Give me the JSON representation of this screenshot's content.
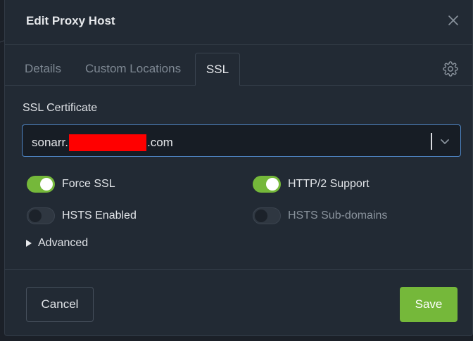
{
  "modal": {
    "title": "Edit Proxy Host"
  },
  "tabs": [
    {
      "label": "Details",
      "active": false
    },
    {
      "label": "Custom Locations",
      "active": false
    },
    {
      "label": "SSL",
      "active": true
    }
  ],
  "ssl": {
    "certificate_label": "SSL Certificate",
    "certificate_value_prefix": "sonarr.",
    "certificate_value_suffix": ".com",
    "toggles": {
      "force_ssl": {
        "label": "Force SSL",
        "on": true
      },
      "http2": {
        "label": "HTTP/2 Support",
        "on": true
      },
      "hsts": {
        "label": "HSTS Enabled",
        "on": false
      },
      "hsts_subdomains": {
        "label": "HSTS Sub-domains",
        "on": false,
        "disabled": true
      }
    },
    "advanced_label": "Advanced"
  },
  "footer": {
    "cancel_label": "Cancel",
    "save_label": "Save"
  },
  "colors": {
    "accent_green": "#75b83a",
    "focus_border": "#4f86c6",
    "redaction": "#ff0000"
  },
  "icons": {
    "close": "close-icon",
    "settings": "gear-icon",
    "dropdown": "chevron-down-icon",
    "expand": "triangle-right-icon"
  }
}
